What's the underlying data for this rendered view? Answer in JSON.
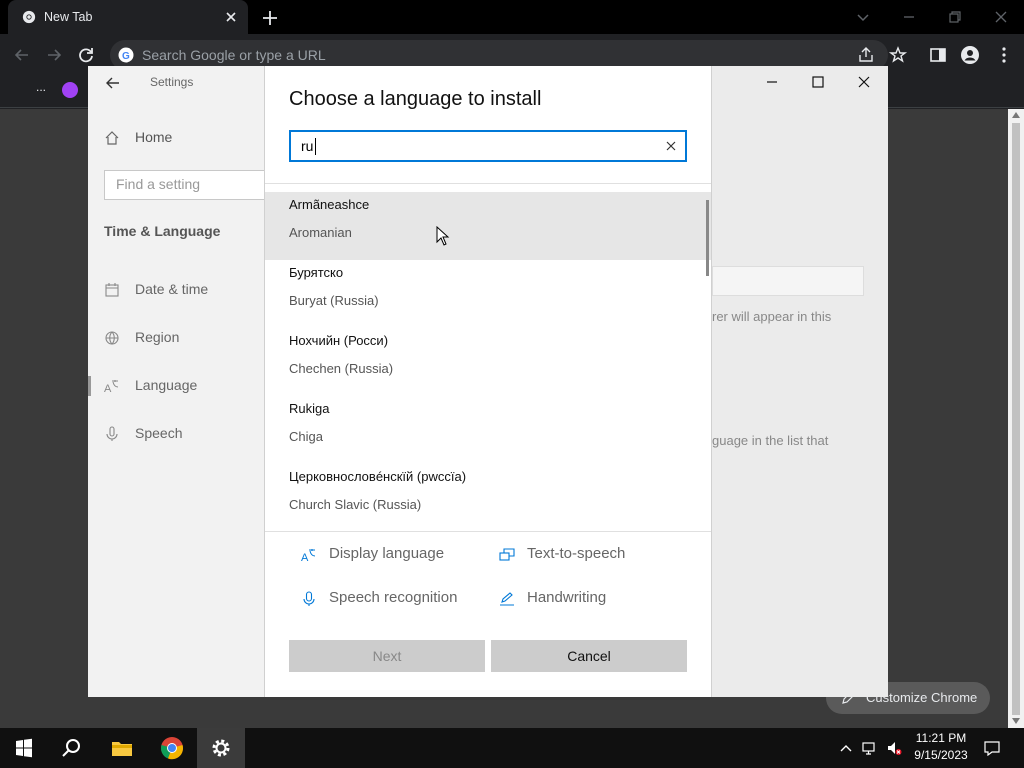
{
  "chrome": {
    "tab_title": "New Tab",
    "omnibox_placeholder": "Search Google or type a URL",
    "bookmarks_more": "...",
    "customize_label": "Customize Chrome"
  },
  "settings": {
    "title": "Settings",
    "home": "Home",
    "find_placeholder": "Find a setting",
    "section": "Time & Language",
    "nav": [
      {
        "label": "Date & time",
        "icon": "calendar-icon"
      },
      {
        "label": "Region",
        "icon": "globe-icon"
      },
      {
        "label": "Language",
        "icon": "language-icon"
      },
      {
        "label": "Speech",
        "icon": "microphone-icon"
      }
    ],
    "right_text_1": "rer will appear in this",
    "right_text_2": "guage in the list that"
  },
  "dialog": {
    "title": "Choose a language to install",
    "search_value": "ru",
    "languages": [
      {
        "native": "Armãneashce",
        "english": "Aromanian",
        "selected": true
      },
      {
        "native": "Бурятско",
        "english": "Buryat (Russia)",
        "selected": false
      },
      {
        "native": "Нохчийн (Росси)",
        "english": "Chechen (Russia)",
        "selected": false
      },
      {
        "native": "Rukiga",
        "english": "Chiga",
        "selected": false
      },
      {
        "native": "Церковнословéнскїй (рwссїа)",
        "english": "Church Slavic (Russia)",
        "selected": false
      }
    ],
    "features": {
      "display_language": "Display language",
      "text_to_speech": "Text-to-speech",
      "speech_recognition": "Speech recognition",
      "handwriting": "Handwriting"
    },
    "next_label": "Next",
    "cancel_label": "Cancel"
  },
  "taskbar": {
    "time": "11:21 PM",
    "date": "9/15/2023"
  },
  "colors": {
    "accent": "#0078d7",
    "selected_row": "#e6e6e6",
    "button_gray": "#cccccc"
  }
}
